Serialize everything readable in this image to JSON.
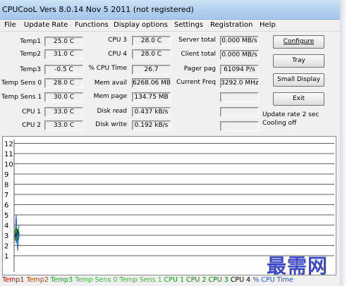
{
  "window": {
    "title": "CPUCooL  Vers 8.0.14  Nov  5 2011 (not registered)"
  },
  "menu": [
    {
      "label": "File",
      "name": "menu-file"
    },
    {
      "label": "Update Rate",
      "name": "menu-update-rate"
    },
    {
      "label": "Functions",
      "name": "menu-functions"
    },
    {
      "label": "Display options",
      "name": "menu-display-options"
    },
    {
      "label": "Settings",
      "name": "menu-settings"
    },
    {
      "label": "Registration",
      "name": "menu-registration"
    },
    {
      "label": "Help",
      "name": "menu-help"
    }
  ],
  "readings": {
    "temp1": {
      "label": "Temp1",
      "value": "25.0 C"
    },
    "temp2": {
      "label": "Temp2",
      "value": "31.0 C"
    },
    "temp3": {
      "label": "Temp3",
      "value": "-0.5 C"
    },
    "temp_sens0": {
      "label": "Temp Sens 0",
      "value": "28.0 C"
    },
    "temp_sens1": {
      "label": "Temp Sens 1",
      "value": "30.0 C"
    },
    "cpu1": {
      "label": "CPU 1",
      "value": "33.0 C"
    },
    "cpu2": {
      "label": "CPU 2",
      "value": "33.0 C"
    },
    "cpu3": {
      "label": "CPU 3",
      "value": "28.0 C"
    },
    "cpu4": {
      "label": "CPU 4",
      "value": "28.0 C"
    },
    "cpu_time": {
      "label": "% CPU Time",
      "value": "26.7"
    },
    "mem_avail": {
      "label": "Mem avail",
      "value": "6268.06 MB"
    },
    "mem_page": {
      "label": "Mem page",
      "value": "134.75 MB"
    },
    "disk_read": {
      "label": "Disk read",
      "value": "0.437 kB/s"
    },
    "disk_write": {
      "label": "Disk write",
      "value": "0.192 kB/s"
    },
    "server_total": {
      "label": "Server total",
      "value": "0.000 MB/s"
    },
    "client_total": {
      "label": "Client total",
      "value": "0.000 MB/s"
    },
    "pager_pag": {
      "label": "Pager pag",
      "value": "61094 P/s"
    },
    "current_freq": {
      "label": "Current Freq",
      "value": "3292.0 MHz"
    },
    "extra1": {
      "value": ""
    },
    "extra2": {
      "value": ""
    },
    "extra3": {
      "value": ""
    }
  },
  "buttons": {
    "configure": "Configure",
    "tray": "Tray",
    "small_display": "Small Display",
    "exit": "Exit"
  },
  "status": {
    "update_rate": "Update rate 2 sec",
    "cooling": "Cooling off"
  },
  "chart_data": {
    "type": "line",
    "yticks": [
      "12",
      "11",
      "10",
      "9",
      "8",
      "7",
      "6",
      "5",
      "4",
      "3",
      "2",
      "1"
    ],
    "ylim": [
      0,
      13
    ],
    "grid": true,
    "series": [
      {
        "name": "Temp1",
        "color": "#e00000",
        "values": [
          2.5,
          3.0,
          2.6,
          3.2
        ]
      },
      {
        "name": "Temp2",
        "color": "#c04000",
        "values": [
          3.1,
          2.4,
          3.6,
          2.8
        ]
      },
      {
        "name": "Temp3",
        "color": "#20a020",
        "values": [
          3.5,
          2.2,
          3.0,
          4.0
        ]
      },
      {
        "name": "Temp Sens 0",
        "color": "#30c030",
        "values": [
          2.8,
          3.4,
          2.5,
          3.1
        ]
      },
      {
        "name": "Temp Sens 1",
        "color": "#40b840",
        "values": [
          3.0,
          3.7,
          2.7,
          3.3
        ]
      },
      {
        "name": "CPU 1",
        "color": "#10a010",
        "values": [
          3.3,
          2.6,
          3.5,
          3.0
        ]
      },
      {
        "name": "CPU 2",
        "color": "#108010",
        "values": [
          3.3,
          3.8,
          2.9,
          3.4
        ]
      },
      {
        "name": "CPU 3",
        "color": "#008000",
        "values": [
          2.8,
          3.2,
          2.5,
          3.0
        ]
      },
      {
        "name": "CPU 4",
        "color": "#000000",
        "values": [
          2.8,
          3.1,
          3.6,
          2.9
        ]
      },
      {
        "name": "% CPU Time",
        "color": "#1e5ad8",
        "values": [
          2.7,
          5.0,
          1.5,
          3.3
        ]
      }
    ]
  },
  "legend_colors": {
    "Temp1": "#e00000",
    "Temp2": "#c04000",
    "Temp3": "#20a020",
    "Temp Sens 0": "#30c030",
    "Temp Sens 1": "#40b840",
    "CPU 1": "#10a010",
    "CPU 2": "#108010",
    "CPU 3": "#008000",
    "CPU 4": "#000000",
    "% CPU Time": "#1e5ad8"
  },
  "watermark": "最需网"
}
